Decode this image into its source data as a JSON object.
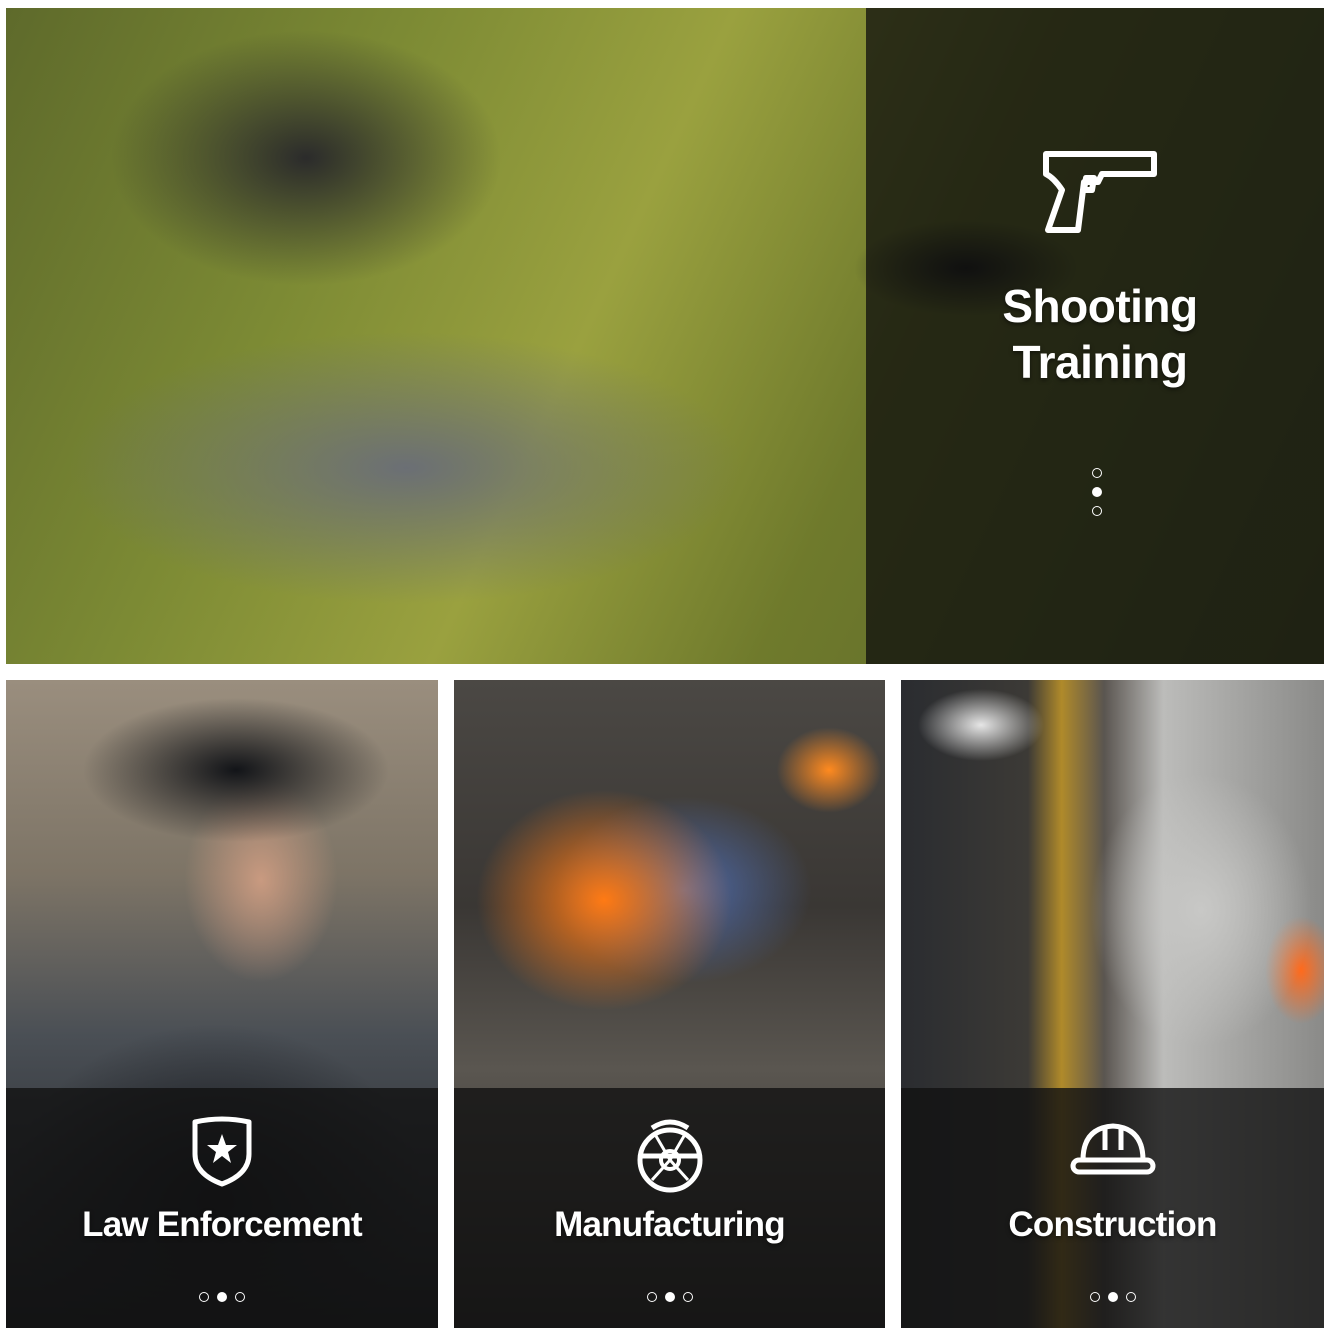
{
  "hero": {
    "title_line1": "Shooting",
    "title_line2": "Training",
    "icon": "pistol-icon",
    "dots": 3,
    "active_dot": 1
  },
  "cards": [
    {
      "title": "Law Enforcement",
      "icon": "police-badge-star-icon",
      "dots": 3,
      "active_dot": 1
    },
    {
      "title": "Manufacturing",
      "icon": "circular-saw-blade-icon",
      "dots": 3,
      "active_dot": 1
    },
    {
      "title": "Construction",
      "icon": "hard-hat-icon",
      "dots": 3,
      "active_dot": 1
    }
  ],
  "colors": {
    "overlay": "#121212",
    "text": "#ffffff",
    "background": "#ffffff"
  }
}
